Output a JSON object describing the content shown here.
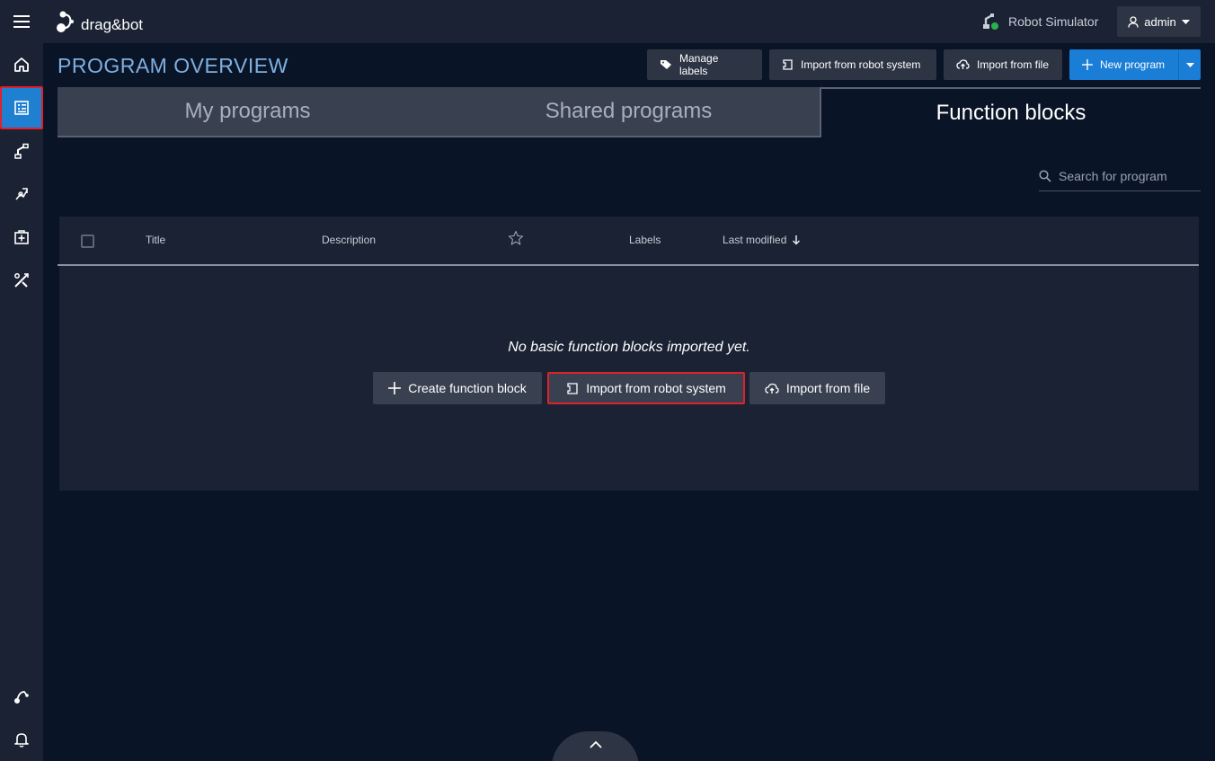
{
  "app": {
    "logo_text": "drag&bot"
  },
  "topbar": {
    "robot_name": "Robot Simulator",
    "robot_status_color": "#2bb24c",
    "user_label": "admin"
  },
  "sidebar": {
    "items": [
      {
        "name": "home",
        "icon": "home-icon"
      },
      {
        "name": "programs",
        "icon": "program-list-icon",
        "active": true
      },
      {
        "name": "robot",
        "icon": "robot-arm-icon"
      },
      {
        "name": "skills",
        "icon": "skills-icon"
      },
      {
        "name": "add-on",
        "icon": "medkit-icon"
      },
      {
        "name": "tools",
        "icon": "tools-icon"
      }
    ],
    "bottom_items": [
      {
        "name": "path",
        "icon": "path-icon"
      },
      {
        "name": "notifications",
        "icon": "bell-icon"
      }
    ]
  },
  "header": {
    "title": "PROGRAM OVERVIEW",
    "manage_labels": "Manage labels",
    "import_robot": "Import from robot system",
    "import_file": "Import from file",
    "new_program": "New program"
  },
  "tabs": [
    {
      "label": "My programs",
      "active": false
    },
    {
      "label": "Shared programs",
      "active": false
    },
    {
      "label": "Function blocks",
      "active": true
    }
  ],
  "search": {
    "placeholder": "Search for program"
  },
  "table": {
    "columns": [
      "Title",
      "Description",
      "Labels",
      "Last modified"
    ],
    "sort_column": "Last modified",
    "sort_direction": "descending",
    "rows": []
  },
  "empty_state": {
    "message": "No basic function blocks imported yet.",
    "create": "Create function block",
    "import_robot": "Import from robot system",
    "import_file": "Import from file"
  },
  "colors": {
    "background": "#0a1427",
    "panel": "#1a2233",
    "accent": "#1a7dd6",
    "highlight": "#e0202a"
  }
}
